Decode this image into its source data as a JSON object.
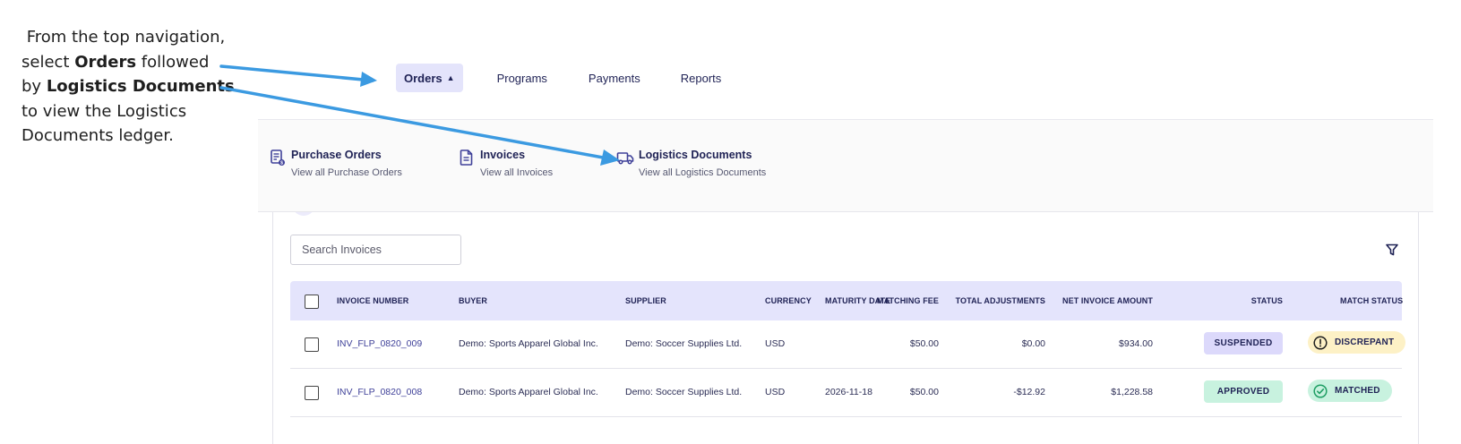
{
  "callout": {
    "line1": " From the top navigation,",
    "line2_pre": "select ",
    "line2_bold": "Orders",
    "line2_post": " followed",
    "line3_pre": "by ",
    "line3_bold": "Logistics Documents",
    "line4": "to view the Logistics",
    "line5": "Documents ledger."
  },
  "topnav": {
    "orders": "Orders",
    "programs": "Programs",
    "payments": "Payments",
    "reports": "Reports"
  },
  "dropdown": {
    "items": [
      {
        "title": "Purchase Orders",
        "subtitle": "View all Purchase Orders",
        "icon": "purchase-order-icon"
      },
      {
        "title": "Invoices",
        "subtitle": "View all Invoices",
        "icon": "invoice-document-icon"
      },
      {
        "title": "Logistics Documents",
        "subtitle": "View all Logistics Documents",
        "icon": "truck-icon"
      }
    ]
  },
  "search": {
    "placeholder": "Search Invoices"
  },
  "table": {
    "headers": [
      "INVOICE NUMBER",
      "BUYER",
      "SUPPLIER",
      "CURRENCY",
      "MATURITY DATE",
      "MATCHING FEE",
      "TOTAL ADJUSTMENTS",
      "NET INVOICE AMOUNT",
      "STATUS",
      "MATCH STATUS"
    ],
    "rows": [
      {
        "invoice_number": "INV_FLP_0820_009",
        "buyer": "Demo: Sports Apparel Global Inc.",
        "supplier": "Demo: Soccer Supplies Ltd.",
        "currency": "USD",
        "maturity_date": "",
        "matching_fee": "$50.00",
        "total_adjustments": "$0.00",
        "net_invoice_amount": "$934.00",
        "status": "SUSPENDED",
        "match_status": "DISCREPANT"
      },
      {
        "invoice_number": "INV_FLP_0820_008",
        "buyer": "Demo: Sports Apparel Global Inc.",
        "supplier": "Demo: Soccer Supplies Ltd.",
        "currency": "USD",
        "maturity_date": "2026-11-18",
        "matching_fee": "$50.00",
        "total_adjustments": "-$12.92",
        "net_invoice_amount": "$1,228.58",
        "status": "APPROVED",
        "match_status": "MATCHED"
      }
    ]
  },
  "colors": {
    "accent": "#3b9ae1",
    "nav_active_bg": "#e4e4fb",
    "table_header_bg": "#e4e4fc",
    "suspended_bg": "#dcd9fb",
    "approved_bg": "#c8f2df",
    "discrepant_bg": "#fdf1c6",
    "matched_bg": "#c8f2df",
    "text_primary": "#1f2255",
    "link": "#3f4199"
  }
}
